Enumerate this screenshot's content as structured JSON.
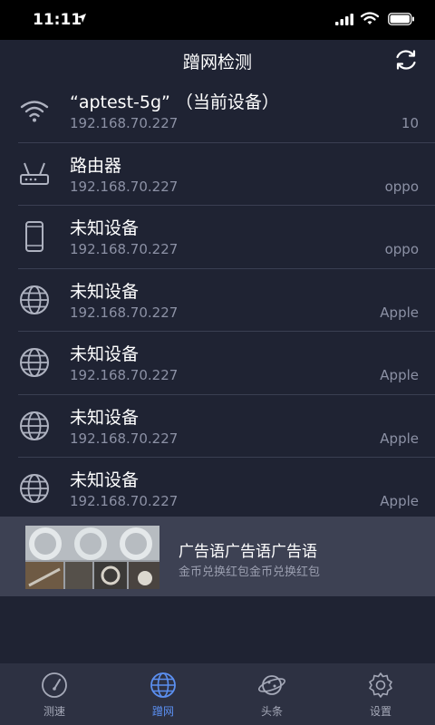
{
  "status_bar": {
    "time": "11:11"
  },
  "header": {
    "title": "蹭网检测"
  },
  "devices": [
    {
      "icon": "wifi-icon",
      "name": "“aptest-5g” （当前设备）",
      "ip": "192.168.70.227",
      "vendor": "10"
    },
    {
      "icon": "router-icon",
      "name": "路由器",
      "ip": "192.168.70.227",
      "vendor": "oppo"
    },
    {
      "icon": "phone-icon",
      "name": "未知设备",
      "ip": "192.168.70.227",
      "vendor": "oppo"
    },
    {
      "icon": "globe-icon",
      "name": "未知设备",
      "ip": "192.168.70.227",
      "vendor": "Apple"
    },
    {
      "icon": "globe-icon",
      "name": "未知设备",
      "ip": "192.168.70.227",
      "vendor": "Apple"
    },
    {
      "icon": "globe-icon",
      "name": "未知设备",
      "ip": "192.168.70.227",
      "vendor": "Apple"
    },
    {
      "icon": "globe-icon",
      "name": "未知设备",
      "ip": "192.168.70.227",
      "vendor": "Apple"
    }
  ],
  "ad": {
    "title": "广告语广告语广告语",
    "subtitle": "金币兑换红包金币兑换红包"
  },
  "tabs": [
    {
      "label": "测速",
      "icon": "speedometer-icon"
    },
    {
      "label": "蹭网",
      "icon": "globe-icon",
      "active": true
    },
    {
      "label": "头条",
      "icon": "planet-icon"
    },
    {
      "label": "设置",
      "icon": "gear-icon"
    }
  ],
  "colors": {
    "background": "#1f2333",
    "active_tab": "#5b8ff0",
    "secondary_text": "#8c91a5"
  }
}
